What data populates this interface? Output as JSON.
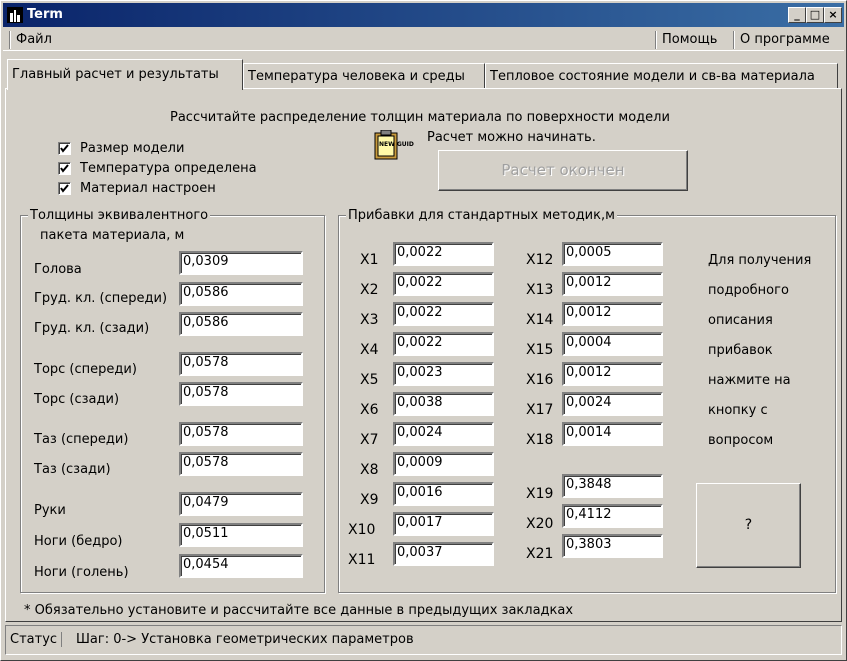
{
  "window": {
    "title": "Term",
    "minimize_label": "_",
    "maximize_label": "□",
    "close_label": "×"
  },
  "menu": {
    "file": "Файл",
    "help": "Помощь",
    "about": "О программе"
  },
  "tabs": [
    {
      "label": "Главный расчет и результаты"
    },
    {
      "label": "Температура человека и среды"
    },
    {
      "label": "Тепловое состояние модели и св-ва материала"
    }
  ],
  "main": {
    "instruction": "Рассчитайте распределение толщин материала по поверхности модели",
    "calc_status": "Расчет можно начинать.",
    "calc_button": "Расчет окончен",
    "icon_label": "NEW GUID",
    "checks": [
      {
        "label": "Размер модели",
        "checked": true
      },
      {
        "label": "Температура определена",
        "checked": true
      },
      {
        "label": "Материал настроен",
        "checked": true
      }
    ]
  },
  "thickness": {
    "title_line1": "Толщины эквивалентного",
    "title_line2": "пакета материала, м",
    "rows": [
      {
        "label": "Голова",
        "value": "0,0309"
      },
      {
        "label": "Груд. кл.  (спереди)",
        "value": "0,0586"
      },
      {
        "label": "Груд. кл.     (сзади)",
        "value": "0,0586"
      },
      {
        "label": "Торс (спереди)",
        "value": "0,0578"
      },
      {
        "label": "Торс    (сзади)",
        "value": "0,0578"
      },
      {
        "label": "Таз (спереди)",
        "value": "0,0578"
      },
      {
        "label": "Таз    (сзади)",
        "value": "0,0578"
      },
      {
        "label": "Руки",
        "value": "0,0479"
      },
      {
        "label": "Ноги (бедро)",
        "value": "0,0511"
      },
      {
        "label": "Ноги (голень)",
        "value": "0,0454"
      }
    ]
  },
  "allowances": {
    "title": "Прибавки для стандартных методик,м",
    "col1": [
      {
        "label": "X1",
        "value": "0,0022"
      },
      {
        "label": "X2",
        "value": "0,0022"
      },
      {
        "label": "X3",
        "value": "0,0022"
      },
      {
        "label": "X4",
        "value": "0,0022"
      },
      {
        "label": "X5",
        "value": "0,0023"
      },
      {
        "label": "X6",
        "value": "0,0038"
      },
      {
        "label": "X7",
        "value": "0,0024"
      },
      {
        "label": "X8",
        "value": "0,0009"
      },
      {
        "label": "X9",
        "value": "0,0016"
      },
      {
        "label": "X10",
        "value": "0,0017"
      },
      {
        "label": "X11",
        "value": "0,0037"
      }
    ],
    "col2": [
      {
        "label": "X12",
        "value": "0,0005"
      },
      {
        "label": "X13",
        "value": "0,0012"
      },
      {
        "label": "X14",
        "value": "0,0012"
      },
      {
        "label": "X15",
        "value": "0,0004"
      },
      {
        "label": "X16",
        "value": "0,0012"
      },
      {
        "label": "X17",
        "value": "0,0024"
      },
      {
        "label": "X18",
        "value": "0,0014"
      },
      {
        "label": "X19",
        "value": "0,3848"
      },
      {
        "label": "X20",
        "value": "0,4112"
      },
      {
        "label": "X21",
        "value": "0,3803"
      }
    ],
    "help_lines": [
      "Для получения",
      "подробного",
      "описания",
      "прибавок",
      "нажмите на",
      "кнопку с",
      "вопросом"
    ],
    "help_button": "?"
  },
  "footnote": "* Обязательно установите и рассчитайте все данные в предыдущих закладках",
  "status": {
    "label": "Статус",
    "text": "Шаг: 0-> Установка геометрических параметров"
  }
}
